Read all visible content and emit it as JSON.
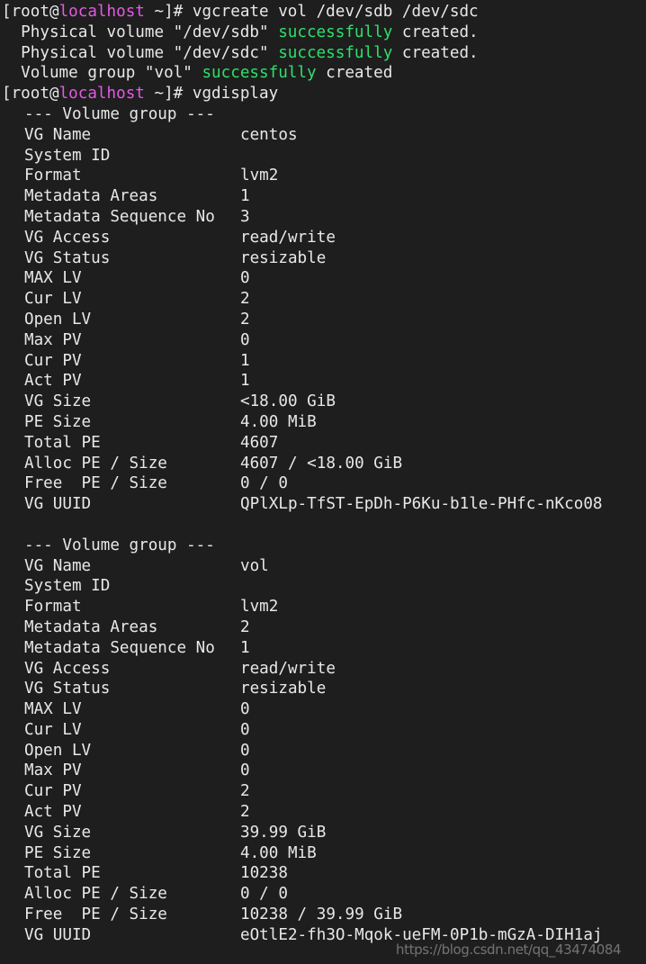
{
  "terminal": {
    "background": "#1e1e1e",
    "foreground": "#e8e8e8",
    "prompt_host_color": "#e45ae4",
    "success_color": "#2ee06a",
    "prompt": {
      "bracket_open": "[",
      "user": "root",
      "at": "@",
      "host": "localhost",
      "path": " ~]# "
    },
    "commands": {
      "vgcreate": "vgcreate vol /dev/sdb /dev/sdc",
      "vgdisplay": "vgdisplay"
    },
    "vgcreate_output": [
      {
        "pre": "  Physical volume \"/dev/sdb\" ",
        "ok": "successfully",
        "post": " created."
      },
      {
        "pre": "  Physical volume \"/dev/sdc\" ",
        "ok": "successfully",
        "post": " created."
      },
      {
        "pre": "  Volume group \"vol\" ",
        "ok": "successfully",
        "post": " created"
      }
    ],
    "group_header": "--- Volume group ---",
    "volume_groups": [
      {
        "rows": [
          {
            "key": "VG Name",
            "value": "centos"
          },
          {
            "key": "System ID",
            "value": ""
          },
          {
            "key": "Format",
            "value": "lvm2"
          },
          {
            "key": "Metadata Areas",
            "value": "1"
          },
          {
            "key": "Metadata Sequence No",
            "value": "3"
          },
          {
            "key": "VG Access",
            "value": "read/write"
          },
          {
            "key": "VG Status",
            "value": "resizable"
          },
          {
            "key": "MAX LV",
            "value": "0"
          },
          {
            "key": "Cur LV",
            "value": "2"
          },
          {
            "key": "Open LV",
            "value": "2"
          },
          {
            "key": "Max PV",
            "value": "0"
          },
          {
            "key": "Cur PV",
            "value": "1"
          },
          {
            "key": "Act PV",
            "value": "1"
          },
          {
            "key": "VG Size",
            "value": "<18.00 GiB"
          },
          {
            "key": "PE Size",
            "value": "4.00 MiB"
          },
          {
            "key": "Total PE",
            "value": "4607"
          },
          {
            "key": "Alloc PE / Size",
            "value": "4607 / <18.00 GiB"
          },
          {
            "key": "Free  PE / Size",
            "value": "0 / 0"
          },
          {
            "key": "VG UUID",
            "value": "QPlXLp-TfST-EpDh-P6Ku-b1le-PHfc-nKco08"
          }
        ]
      },
      {
        "rows": [
          {
            "key": "VG Name",
            "value": "vol"
          },
          {
            "key": "System ID",
            "value": ""
          },
          {
            "key": "Format",
            "value": "lvm2"
          },
          {
            "key": "Metadata Areas",
            "value": "2"
          },
          {
            "key": "Metadata Sequence No",
            "value": "1"
          },
          {
            "key": "VG Access",
            "value": "read/write"
          },
          {
            "key": "VG Status",
            "value": "resizable"
          },
          {
            "key": "MAX LV",
            "value": "0"
          },
          {
            "key": "Cur LV",
            "value": "0"
          },
          {
            "key": "Open LV",
            "value": "0"
          },
          {
            "key": "Max PV",
            "value": "0"
          },
          {
            "key": "Cur PV",
            "value": "2"
          },
          {
            "key": "Act PV",
            "value": "2"
          },
          {
            "key": "VG Size",
            "value": "39.99 GiB"
          },
          {
            "key": "PE Size",
            "value": "4.00 MiB"
          },
          {
            "key": "Total PE",
            "value": "10238"
          },
          {
            "key": "Alloc PE / Size",
            "value": "0 / 0"
          },
          {
            "key": "Free  PE / Size",
            "value": "10238 / 39.99 GiB"
          },
          {
            "key": "VG UUID",
            "value": "eOtlE2-fh3O-Mqok-ueFM-0P1b-mGzA-DIH1aj"
          }
        ]
      }
    ],
    "watermark": "https://blog.csdn.net/qq_43474084"
  }
}
